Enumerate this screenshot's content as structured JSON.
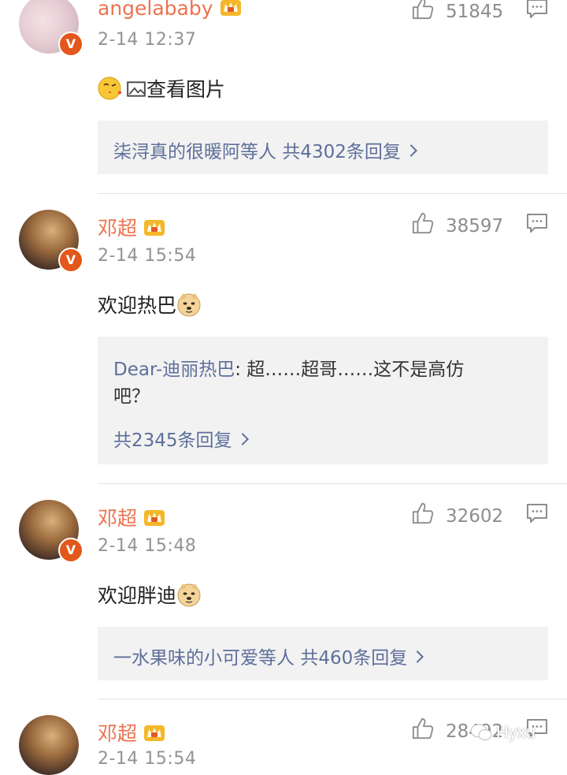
{
  "comments": [
    {
      "user": "angelababy",
      "time": "2-14 12:37",
      "likes": "51845",
      "text": "查看图片",
      "reply_summary": {
        "users": "柒浔真的很暖阿等人",
        "count": "共4302条回复"
      }
    },
    {
      "user": "邓超",
      "time": "2-14 15:54",
      "likes": "38597",
      "text": "欢迎热巴",
      "reply_preview": {
        "author": "Dear-迪丽热巴",
        "text_line1": ": 超……超哥……这不是高仿",
        "text_line2": "吧？"
      },
      "reply_summary": {
        "count": "共2345条回复"
      }
    },
    {
      "user": "邓超",
      "time": "2-14 15:48",
      "likes": "32602",
      "text": "欢迎胖迪",
      "reply_summary": {
        "users": "一水果味的小可爱等人",
        "count": "共460条回复"
      }
    },
    {
      "user": "邓超",
      "time": "2-14 15:54",
      "likes": "28492"
    }
  ],
  "verified_badge": "V",
  "watermark": "Hyxu",
  "colors": {
    "username": "#eb7350",
    "link": "#5d6f9a",
    "badge": "#e3571b",
    "meta": "#939393"
  }
}
